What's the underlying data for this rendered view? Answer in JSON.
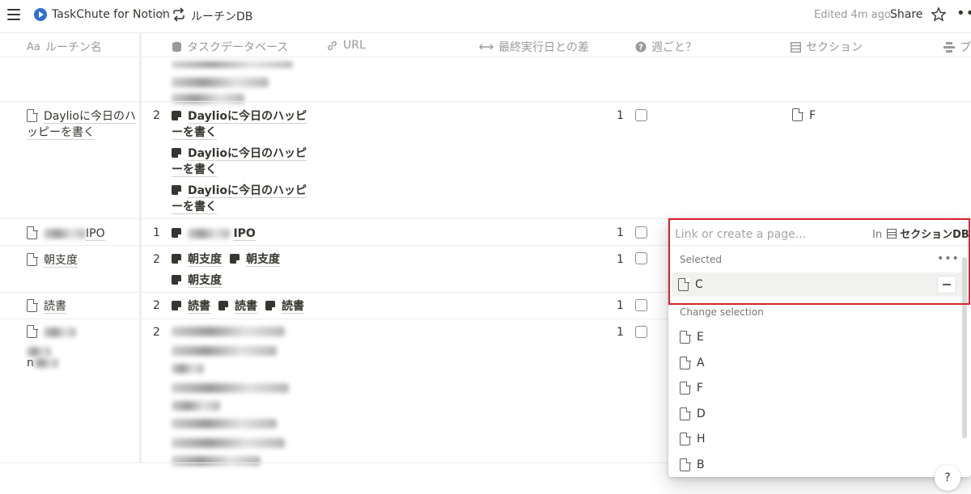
{
  "topbar": {
    "breadcrumb_app": "TaskChute for Notion",
    "separator": "/",
    "breadcrumb_db": "ルーチンDB",
    "edited": "Edited 4m ago",
    "share": "Share",
    "more": "•••"
  },
  "columns": [
    {
      "icon": "Aa",
      "label": "ルーチン名"
    },
    {
      "icon": "db-icon",
      "label": "タスクデータベース"
    },
    {
      "icon": "link-icon",
      "label": "URL"
    },
    {
      "icon": "arrows-icon",
      "label": "最終実行日との差"
    },
    {
      "icon": "question-icon",
      "label": "週ごと？"
    },
    {
      "icon": "db-icon",
      "label": "セクション"
    },
    {
      "icon": "rollup-icon",
      "label": "プ"
    }
  ],
  "rows": [
    {
      "title": "Daylioに今日のハッピーを書く",
      "count": "2",
      "tasks": [
        "Daylioに今日のハッピーを書く",
        "Daylioに今日のハッピーを書く",
        "Daylioに今日のハッピーを書く"
      ],
      "diff": "1",
      "section": "F"
    },
    {
      "title": "IPO",
      "count": "1",
      "tasks": [
        "IPO"
      ],
      "diff": "1",
      "section": ""
    },
    {
      "title": "朝支度",
      "count": "2",
      "tasks": [
        "朝支度",
        "朝支度",
        "朝支度"
      ],
      "diff": "1",
      "section": ""
    },
    {
      "title": "読書",
      "count": "2",
      "tasks": [
        "読書",
        "読書",
        "読書"
      ],
      "diff": "1",
      "section": ""
    },
    {
      "title": "n",
      "count": "2",
      "tasks": [],
      "diff": "1",
      "section": ""
    }
  ],
  "dropdown": {
    "placeholder": "Link or create a page...",
    "in_label": "In",
    "db_name": "セクションDB",
    "selected_label": "Selected",
    "more": "•••",
    "selected_items": [
      "C"
    ],
    "change_label": "Change selection",
    "options": [
      "E",
      "A",
      "F",
      "D",
      "H",
      "B"
    ]
  },
  "help": "?"
}
